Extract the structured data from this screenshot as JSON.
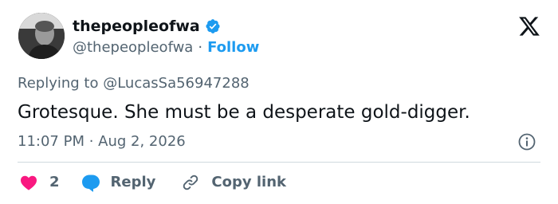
{
  "author": {
    "display_name": "thepeopleofwa",
    "handle": "@thepeopleofwa",
    "separator": "·",
    "follow_label": "Follow",
    "verified_color": "#1d9bf0"
  },
  "reply_context": {
    "prefix": "Replying to",
    "mention": "@LucasSa56947288"
  },
  "tweet": {
    "text": "Grotesque. She must be a desperate gold-digger.",
    "timestamp": "11:07 PM · Aug 2, 2026"
  },
  "actions": {
    "like_count": "2",
    "reply_label": "Reply",
    "copy_link_label": "Copy link"
  },
  "colors": {
    "accent": "#1d9bf0",
    "like": "#f91880",
    "secondary_text": "#536471",
    "primary_text": "#0f1419",
    "divider": "#cfd9de"
  },
  "icons": {
    "logo": "x-logo-icon",
    "verified": "verified-badge-icon",
    "info": "info-icon",
    "like": "heart-icon",
    "reply": "speech-bubble-icon",
    "copy_link": "link-icon"
  }
}
